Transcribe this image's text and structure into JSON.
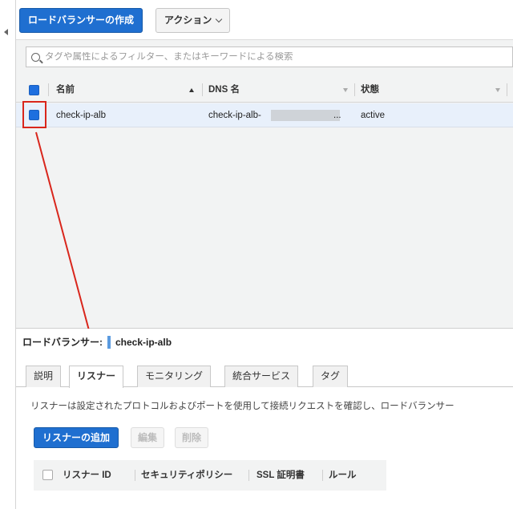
{
  "toolbar": {
    "create_button": "ロードバランサーの作成",
    "actions_button": "アクション"
  },
  "search": {
    "placeholder": "タグや属性によるフィルター、またはキーワードによる検索"
  },
  "table": {
    "columns": [
      "名前",
      "DNS 名",
      "状態"
    ],
    "rows": [
      {
        "name": "check-ip-alb",
        "dns": "check-ip-alb-",
        "dns_suffix": "...",
        "state": "active"
      }
    ]
  },
  "detail": {
    "title_label": "ロードバランサー:",
    "title_value": "check-ip-alb",
    "tabs": [
      "説明",
      "リスナー",
      "モニタリング",
      "統合サービス",
      "タグ"
    ],
    "active_tab": "リスナー",
    "description": "リスナーは設定されたプロトコルおよびポートを使用して接続リクエストを確認し、ロードバランサー",
    "buttons": {
      "add": "リスナーの追加",
      "edit": "編集",
      "delete": "削除"
    },
    "listener_columns": [
      "リスナー ID",
      "セキュリティポリシー",
      "SSL 証明書",
      "ルール"
    ]
  },
  "colors": {
    "primary": "#1f6fd0",
    "highlight": "#d9261c",
    "selected_row": "#e8f0fb"
  }
}
